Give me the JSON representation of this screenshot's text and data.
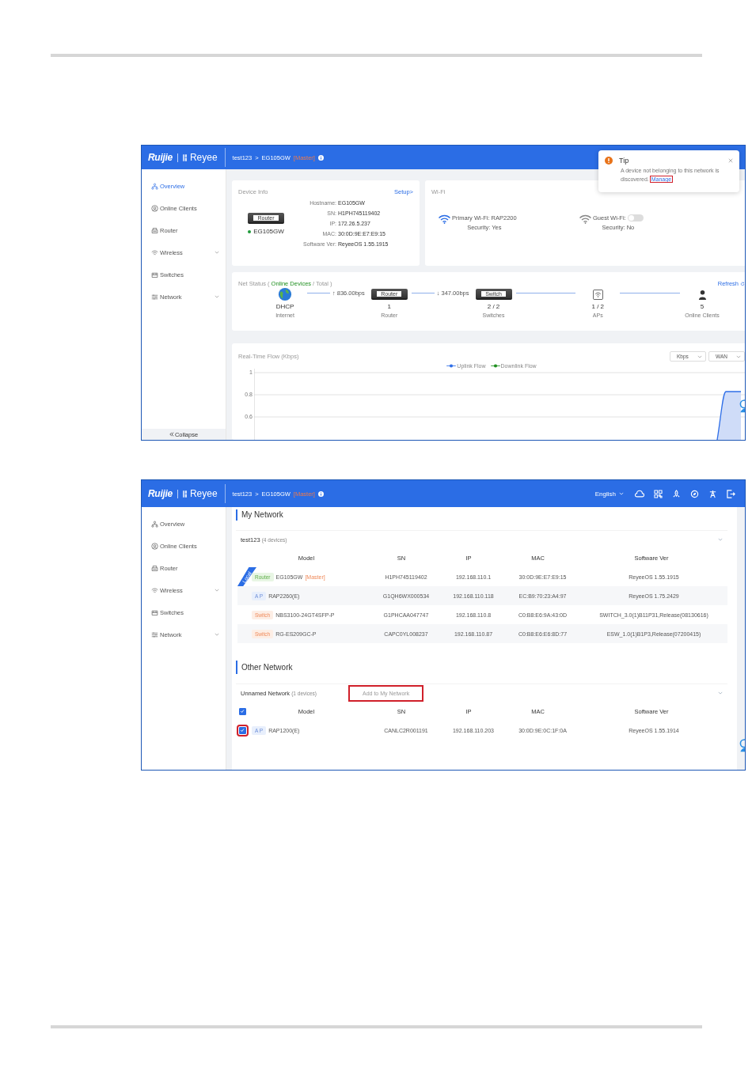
{
  "overview_screen": {
    "header": {
      "logo": "Ruijie",
      "brand": "Reyee",
      "project": "test123",
      "separator": ">",
      "device": "EG105GW",
      "role": "[Master]"
    },
    "sidebar": [
      {
        "label": "Overview",
        "selected": true,
        "expandable": false
      },
      {
        "label": "Online Clients",
        "selected": false,
        "expandable": false
      },
      {
        "label": "Router",
        "selected": false,
        "expandable": false
      },
      {
        "label": "Wireless",
        "selected": false,
        "expandable": true
      },
      {
        "label": "Switches",
        "selected": false,
        "expandable": false
      },
      {
        "label": "Network",
        "selected": false,
        "expandable": true
      }
    ],
    "collapse": "Collapse",
    "device_info": {
      "title": "Device Info",
      "setup": "Setup>",
      "device_label": "Router",
      "name": "EG105GW",
      "online": true,
      "fields": [
        {
          "label": "Hostname:",
          "value": "EG105GW"
        },
        {
          "label": "SN:",
          "value": "H1PH745119402"
        },
        {
          "label": "IP:",
          "value": "172.26.5.237"
        },
        {
          "label": "MAC:",
          "value": "30:0D:9E:E7:E9:15"
        },
        {
          "label": "Software Ver:",
          "value": "ReyeeOS 1.55.1915"
        }
      ]
    },
    "wifi": {
      "title": "Wi-Fi",
      "networks": [
        {
          "kind": "primary",
          "label": "Primary Wi-Fi: RAP2200",
          "security": "Security: Yes",
          "enabled": true
        },
        {
          "kind": "guest",
          "label": "Guest Wi-Fi:",
          "security": "Security: No",
          "enabled": false
        }
      ]
    },
    "net_status": {
      "title": "Net Status (",
      "online": "Online Devices",
      "total": "/ Total )",
      "refresh": "Refresh",
      "nodes": [
        {
          "kind": "internet",
          "value": "DHCP",
          "label": "Internet",
          "link": {
            "rate": "↑ 836.00bps"
          }
        },
        {
          "kind": "router",
          "device_label": "Router",
          "value": "1",
          "label": "Router",
          "link": {
            "rate": "↓ 347.00bps"
          }
        },
        {
          "kind": "switch",
          "device_label": "Switch",
          "value": "2 / 2",
          "label": "Switches"
        },
        {
          "kind": "ap",
          "value": "1 / 2",
          "label": "APs"
        },
        {
          "kind": "clients",
          "value": "5",
          "label": "Online Clients"
        }
      ]
    },
    "flow": {
      "title": "Real-Time Flow (Kbps)",
      "unit": "Kbps",
      "port": "WAN",
      "legend": [
        {
          "name": "Uplink Flow",
          "color": "#2f6fe8"
        },
        {
          "name": "Downlink Flow",
          "color": "#1f8f1f"
        }
      ],
      "y_ticks": [
        "1",
        "0.8",
        "0.6"
      ]
    },
    "tip": {
      "title": "Tip",
      "message": "A device not belonging to this network is discovered.",
      "link": "Manage",
      "highlighted": true
    }
  },
  "network_screen": {
    "header": {
      "logo": "Ruijie",
      "brand": "Reyee",
      "project": "test123",
      "separator": ">",
      "device": "EG105GW",
      "role": "[Master]",
      "language": "English"
    },
    "sidebar": [
      {
        "label": "Overview",
        "selected": false,
        "expandable": false
      },
      {
        "label": "Online Clients",
        "selected": false,
        "expandable": false
      },
      {
        "label": "Router",
        "selected": false,
        "expandable": false
      },
      {
        "label": "Wireless",
        "selected": false,
        "expandable": true
      },
      {
        "label": "Switches",
        "selected": false,
        "expandable": false
      },
      {
        "label": "Network",
        "selected": false,
        "expandable": true
      }
    ],
    "my_network": {
      "title": "My Network",
      "group": "test123",
      "count": "(4 devices)",
      "columns": [
        "Model",
        "SN",
        "IP",
        "MAC",
        "Software Ver"
      ],
      "rows": [
        {
          "kind": "router",
          "tag": "Router",
          "model": "EG105GW",
          "role": "[Master]",
          "ribbon": "Local",
          "sn": "H1PH745119402",
          "ip": "192.168.110.1",
          "mac": "30:0D:9E:E7:E9:15",
          "software": "ReyeeOS 1.55.1915"
        },
        {
          "kind": "ap",
          "tag": "A P",
          "model": "RAP2260(E)",
          "sn": "G1QH6WX000534",
          "ip": "192.168.110.118",
          "mac": "EC:B9:70:23:A4:97",
          "software": "ReyeeOS 1.75.2429"
        },
        {
          "kind": "switch",
          "tag": "Switch",
          "model": "NBS3100-24GT4SFP-P",
          "sn": "G1PHCAA047747",
          "ip": "192.168.110.8",
          "mac": "C0:B8:E6:9A:43:0D",
          "software": "SWITCH_3.0(1)B11P31,Release(08130616)"
        },
        {
          "kind": "switch",
          "tag": "Switch",
          "model": "RG-ES209GC-P",
          "sn": "CAPC0YL008237",
          "ip": "192.168.110.87",
          "mac": "C0:B8:E6:E6:8D:77",
          "software": "ESW_1.0(1)B1P3,Release(07200415)"
        }
      ]
    },
    "other_network": {
      "title": "Other Network",
      "group": "Unnamed Network",
      "count": "(1 devices)",
      "action": "Add to My Network",
      "action_highlighted": true,
      "select_all": true,
      "columns": [
        "Model",
        "SN",
        "IP",
        "MAC",
        "Software Ver"
      ],
      "rows": [
        {
          "kind": "ap",
          "tag": "A P",
          "model": "RAP1200(E)",
          "checked": true,
          "highlighted": true,
          "sn": "CANLC2R001191",
          "ip": "192.168.110.203",
          "mac": "30:0D:9E:0C:1F:0A",
          "software": "ReyeeOS 1.55.1914"
        }
      ]
    }
  }
}
